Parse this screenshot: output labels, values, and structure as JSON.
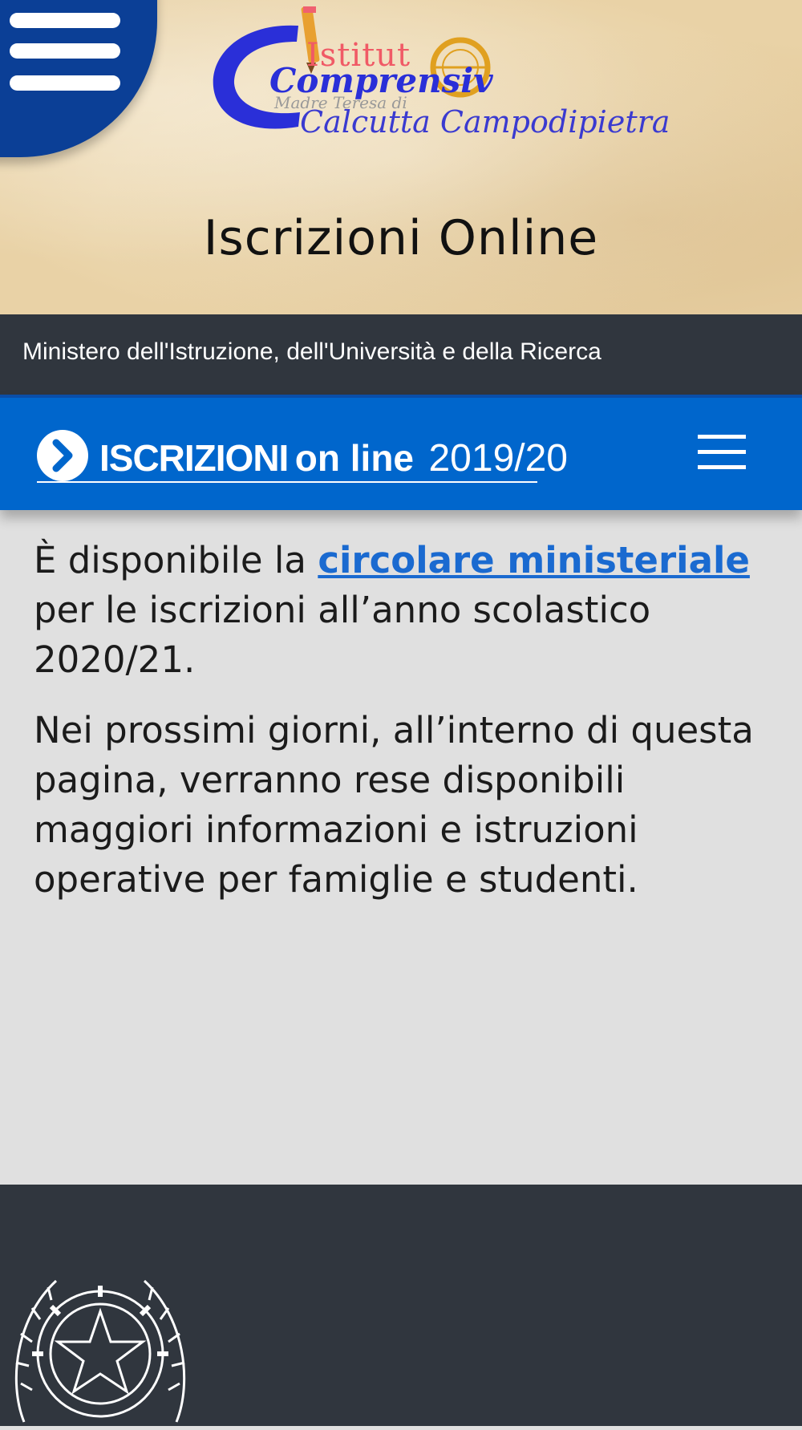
{
  "header": {
    "logo": {
      "line1": "Istitut",
      "line2": "Comprensiv",
      "line3": "Madre Teresa di",
      "line4": "Calcutta Campodipietra"
    },
    "page_title": "Iscrizioni Online",
    "menu_icon": "hamburger-icon"
  },
  "ministry_bar": {
    "text": "Ministero dell'Istruzione, dell'Università e della Ricerca"
  },
  "nav_bar": {
    "brand_icon": "chevron-right-circle-icon",
    "brand_strong": "ISCRIZIONI",
    "brand_online": "on line",
    "brand_year": "2019/20",
    "menu_icon": "hamburger-icon"
  },
  "content": {
    "para1_before": "È disponibile la ",
    "para1_link": "circolare ministeriale",
    "para1_after": " per le iscrizioni all’anno scolastico 2020/21.",
    "para2": "Nei prossimi giorni, all’interno di questa pagina, verranno rese disponibili maggiori informazioni e istruzioni operative per famiglie e studenti."
  },
  "footer": {
    "emblem_icon": "italian-republic-emblem-icon"
  },
  "colors": {
    "primary_blue": "#0066cc",
    "dark_bar": "#30363e",
    "corner_blue": "#0b3f96",
    "link": "#1a6ad0"
  }
}
